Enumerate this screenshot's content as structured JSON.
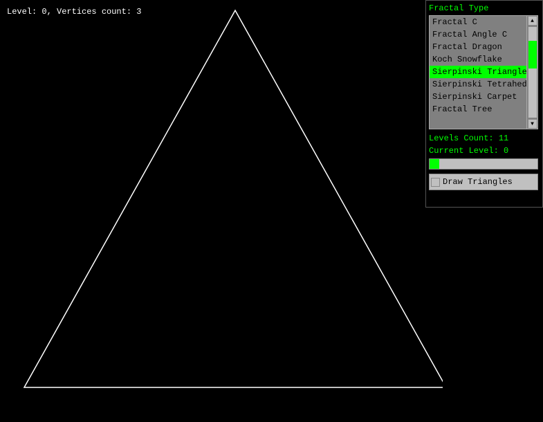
{
  "status": {
    "text": "Level: 0, Vertices count: 3"
  },
  "control_panel": {
    "fractal_type_label": "Fractal Type",
    "fractal_items": [
      {
        "label": "Fractal C",
        "selected": false
      },
      {
        "label": "Fractal Angle C",
        "selected": false
      },
      {
        "label": "Fractal Dragon",
        "selected": false
      },
      {
        "label": "Koch Snowflake",
        "selected": false
      },
      {
        "label": "Sierpinski Triangle",
        "selected": true
      },
      {
        "label": "Sierpinski Tetrahedron",
        "selected": false
      },
      {
        "label": "Sierpinski Carpet",
        "selected": false
      },
      {
        "label": "Fractal Tree",
        "selected": false
      }
    ],
    "levels_count_label": "Levels Count: 11",
    "current_level_label": "Current Level: 0",
    "draw_triangles_label": "Draw Triangles"
  },
  "colors": {
    "background": "#000000",
    "accent": "#00ff00",
    "triangle_stroke": "#ffffff"
  }
}
